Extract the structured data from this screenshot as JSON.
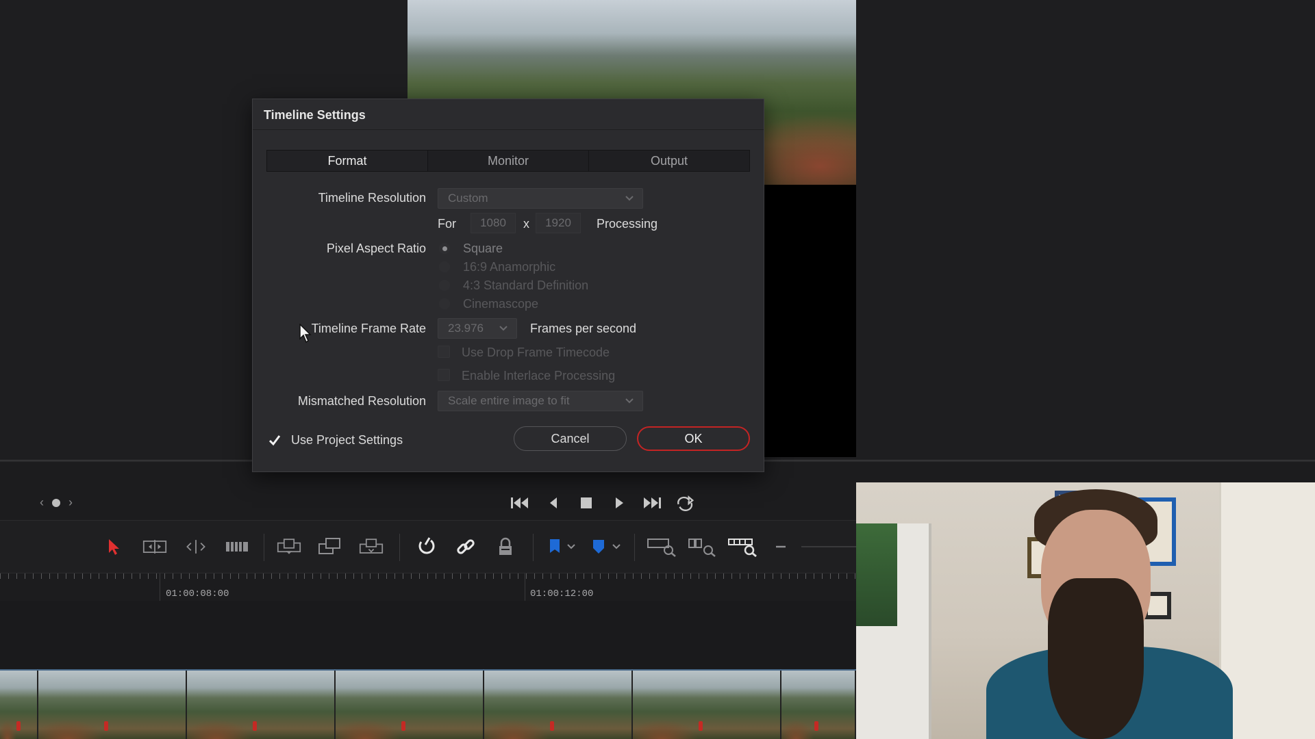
{
  "dialog": {
    "title": "Timeline Settings",
    "tabs": [
      {
        "label": "Format",
        "active": true
      },
      {
        "label": "Monitor",
        "active": false
      },
      {
        "label": "Output",
        "active": false
      }
    ],
    "timeline_resolution": {
      "label": "Timeline Resolution",
      "value": "Custom"
    },
    "size": {
      "for_label": "For",
      "width": "1080",
      "x_label": "x",
      "height": "1920",
      "processing_label": "Processing"
    },
    "pixel_aspect_ratio": {
      "label": "Pixel Aspect Ratio",
      "options": [
        {
          "label": "Square",
          "selected": true
        },
        {
          "label": "16:9 Anamorphic",
          "selected": false
        },
        {
          "label": "4:3 Standard Definition",
          "selected": false
        },
        {
          "label": "Cinemascope",
          "selected": false
        }
      ]
    },
    "frame_rate": {
      "label": "Timeline Frame Rate",
      "value": "23.976",
      "unit": "Frames per second"
    },
    "drop_frame": {
      "label": "Use Drop Frame Timecode",
      "checked": false
    },
    "interlace": {
      "label": "Enable Interlace Processing",
      "checked": false
    },
    "mismatched_resolution": {
      "label": "Mismatched Resolution",
      "value": "Scale entire image to fit"
    },
    "use_project_settings": {
      "label": "Use Project Settings",
      "checked": true
    },
    "cancel_label": "Cancel",
    "ok_label": "OK"
  },
  "timeline": {
    "timecodes": [
      "01:00:08:00",
      "01:00:12:00"
    ]
  },
  "colors": {
    "accent_red": "#c42424",
    "flag_blue": "#1e6ad6",
    "selection_red": "#e03030"
  },
  "icons": {
    "transport": [
      "skip-to-start-icon",
      "step-back-icon",
      "stop-icon",
      "play-icon",
      "skip-to-end-icon",
      "loop-icon"
    ],
    "toolbar": [
      "selection-arrow-icon",
      "trim-edit-icon",
      "dynamic-trim-icon",
      "blade-icon",
      "insert-clip-icon",
      "overwrite-clip-icon",
      "replace-clip-icon",
      "snapping-icon",
      "linked-selection-icon",
      "position-lock-icon",
      "flag-icon",
      "marker-icon",
      "zoom-full-icon",
      "zoom-detail-icon",
      "zoom-custom-icon",
      "zoom-out-icon"
    ]
  }
}
